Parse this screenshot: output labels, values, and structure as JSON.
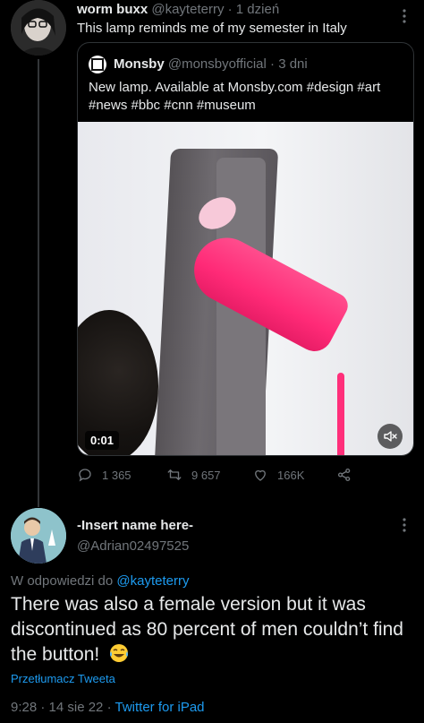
{
  "tweet": {
    "author_name": "worm buxx",
    "author_handle": "@kayteterry",
    "separator": "·",
    "time": "1 dzień",
    "text": "This lamp reminds me of my semester in Italy"
  },
  "quote": {
    "author_name": "Monsby",
    "author_handle": "@monsbyofficial",
    "separator": "·",
    "time": "3 dni",
    "text": "New lamp. Available at Monsby.com #design #art #news #bbc #cnn #museum",
    "video_time": "0:01"
  },
  "actions": {
    "replies": "1 365",
    "retweets": "9 657",
    "likes": "166K"
  },
  "reply": {
    "author_name": "-Insert name here-",
    "author_handle": "@Adrian02497525",
    "reply_prefix": "W odpowiedzi do",
    "reply_to_handle": "@kayteterry",
    "text": "There was also a female version but it was discontinued as 80 percent of men couldn’t find the button!",
    "translate_label": "Przetłumacz Tweeta",
    "timestamp": "9:28 · 14 sie 22 ·",
    "source": "Twitter for iPad"
  },
  "icons": {
    "reply": "speech-bubble-icon",
    "retweet": "retweet-icon",
    "like": "heart-icon",
    "share": "share-icon",
    "more": "more-vertical-icon",
    "mute": "speaker-muted-icon",
    "emoji": "face-with-tears-of-joy"
  },
  "colors": {
    "background": "#000000",
    "text": "#e7e9ea",
    "muted": "#71767b",
    "link": "#1d9bf0",
    "border": "#2f3336",
    "lamp_pink": "#ff2a77"
  }
}
